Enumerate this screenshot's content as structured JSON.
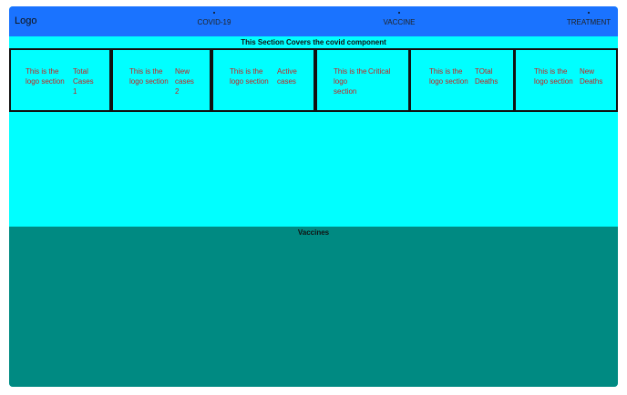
{
  "header": {
    "logo": "Logo",
    "nav": [
      {
        "label": "COVID-19"
      },
      {
        "label": "VACCINE"
      },
      {
        "label": "TREATMENT"
      }
    ]
  },
  "covid_section": {
    "title": "This Section Covers the covid component",
    "cards": [
      {
        "logo_text": "This is the\nlogo section",
        "stat_text": "Total\nCases\n1"
      },
      {
        "logo_text": "This is the\nlogo section",
        "stat_text": "New\ncases\n2"
      },
      {
        "logo_text": "This is the\nlogo section",
        "stat_text": "Active\ncases"
      },
      {
        "logo_text": "This is the\nlogo\nsection",
        "stat_text": "Critical"
      },
      {
        "logo_text": "This is the\nlogo section",
        "stat_text": "TOtal\nDeaths"
      },
      {
        "logo_text": "This is the\nlogo section",
        "stat_text": "New\nDeaths"
      }
    ]
  },
  "vaccine_section": {
    "title": "Vaccines"
  },
  "colors": {
    "header": "#1a73ff",
    "covid_bg": "#00ffff",
    "vaccine_bg": "#008a82",
    "card_text": "#c8201f"
  }
}
